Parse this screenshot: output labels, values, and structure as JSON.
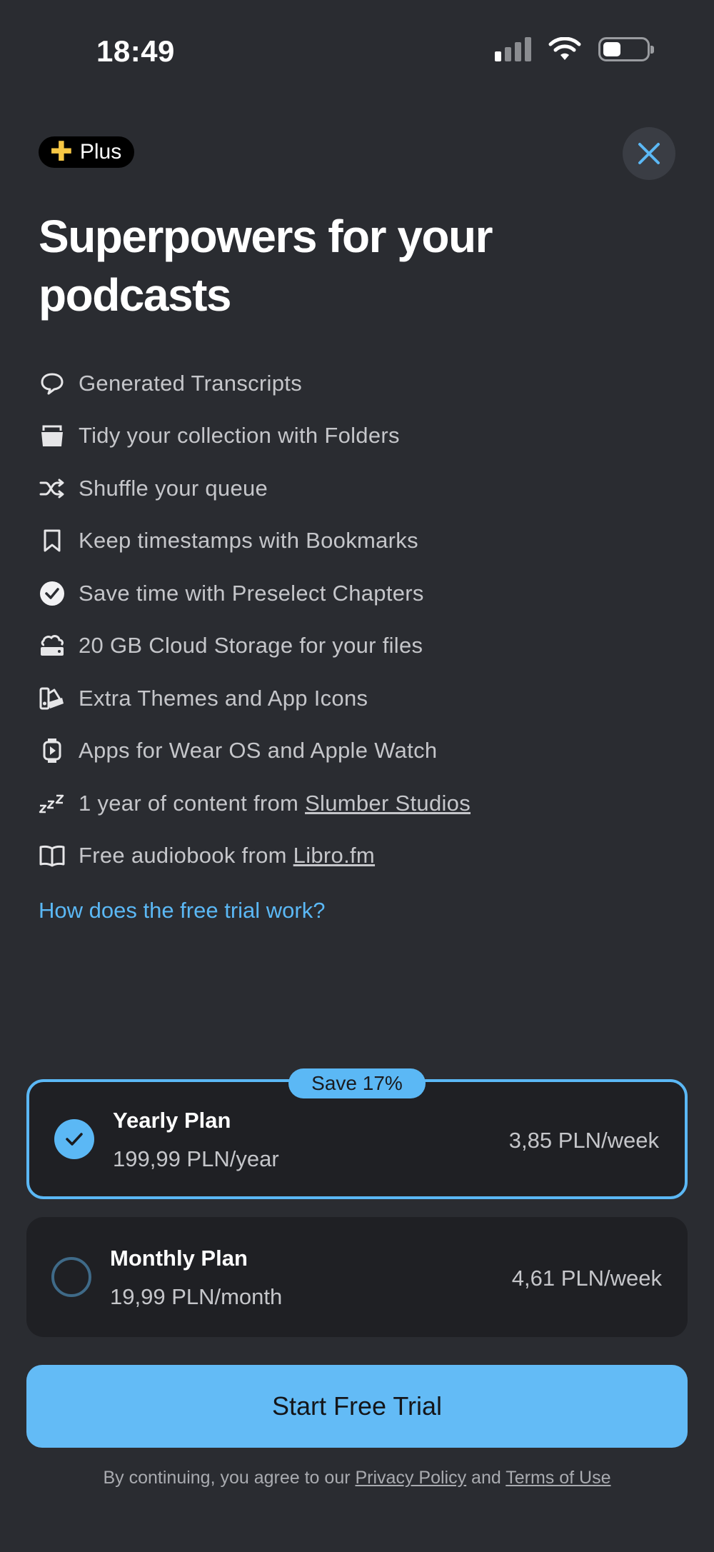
{
  "status_bar": {
    "time": "18:49"
  },
  "badge": {
    "label": "Plus"
  },
  "headline": "Superpowers for your podcasts",
  "features": [
    {
      "icon": "speech-bubble-icon",
      "text": "Generated Transcripts"
    },
    {
      "icon": "folder-icon",
      "text": "Tidy your collection with Folders"
    },
    {
      "icon": "shuffle-icon",
      "text": "Shuffle your queue"
    },
    {
      "icon": "bookmark-icon",
      "text": "Keep timestamps with Bookmarks"
    },
    {
      "icon": "checkmark-circle-icon",
      "text": "Save time with Preselect Chapters"
    },
    {
      "icon": "cloud-storage-icon",
      "text": "20 GB Cloud Storage for your files"
    },
    {
      "icon": "palette-icon",
      "text": "Extra Themes and App Icons"
    },
    {
      "icon": "watch-icon",
      "text": "Apps for Wear OS and Apple Watch"
    },
    {
      "icon": "sleep-zzz-icon",
      "text": "1 year of content from ",
      "link": "Slumber Studios"
    },
    {
      "icon": "book-icon",
      "text": "Free audiobook from ",
      "link": "Libro.fm"
    }
  ],
  "trial_link": "How does the free trial work?",
  "plans": {
    "yearly": {
      "badge": "Save 17%",
      "name": "Yearly Plan",
      "price": "199,99 PLN/year",
      "weekly": "3,85 PLN/week",
      "selected": true
    },
    "monthly": {
      "name": "Monthly Plan",
      "price": "19,99 PLN/month",
      "weekly": "4,61 PLN/week",
      "selected": false
    }
  },
  "cta": "Start Free Trial",
  "legal": {
    "prefix": "By continuing, you agree to our ",
    "privacy": "Privacy Policy",
    "and": " and ",
    "terms": "Terms of Use"
  },
  "colors": {
    "background": "#2a2c31",
    "accent": "#5bb8f5",
    "plus": "#f7c744"
  }
}
